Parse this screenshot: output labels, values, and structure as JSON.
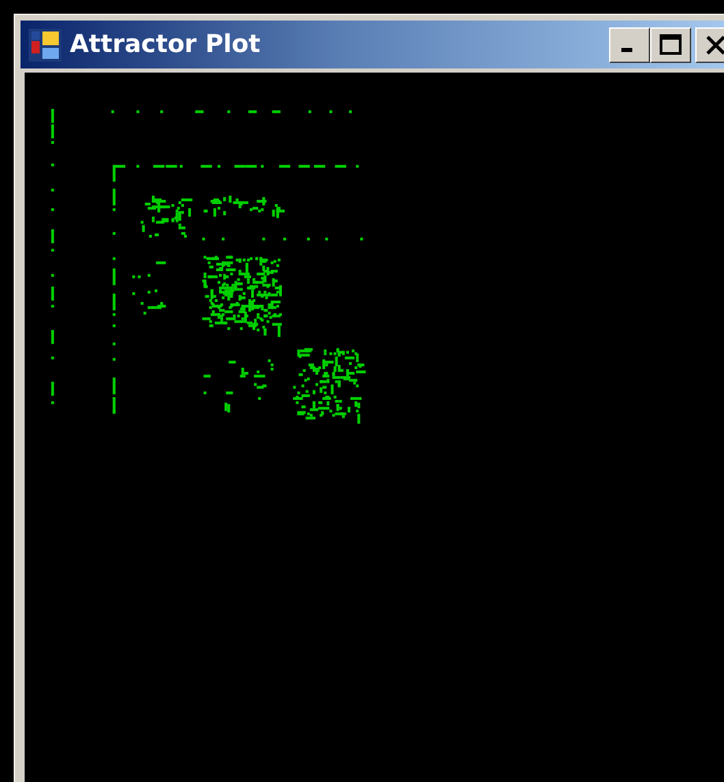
{
  "window": {
    "title": "Attractor Plot"
  }
}
